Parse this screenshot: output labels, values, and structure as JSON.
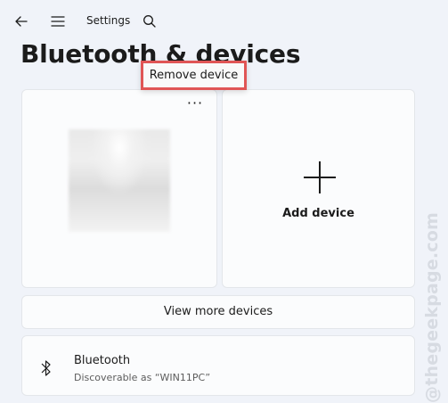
{
  "app": {
    "title": "Settings"
  },
  "page": {
    "title": "Bluetooth & devices"
  },
  "icons": {
    "back": "back-arrow-icon",
    "menu": "hamburger-menu-icon",
    "search": "search-icon",
    "more": "more-options-icon",
    "add": "plus-icon",
    "bluetooth": "bluetooth-icon"
  },
  "context_menu": {
    "items": [
      {
        "label": "Remove device"
      }
    ],
    "highlight_color": "#e05555"
  },
  "device_tile": {
    "more_label": "···"
  },
  "add_tile": {
    "label": "Add device"
  },
  "view_more": {
    "label": "View more devices"
  },
  "bluetooth": {
    "title": "Bluetooth",
    "subtitle": "Discoverable as “WIN11PC”"
  },
  "watermark": {
    "text": "@thegeekpage.com"
  }
}
